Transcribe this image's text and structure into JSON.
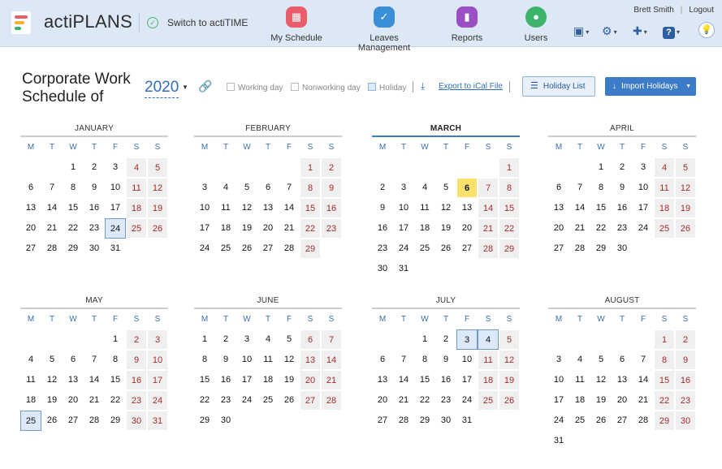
{
  "app": {
    "name": "actiPLANS",
    "switch_label": "Switch to actiTIME"
  },
  "nav": [
    {
      "label": "My Schedule",
      "icon": "calendar-icon",
      "color": "#e95d6b"
    },
    {
      "label": "Leaves Management",
      "icon": "leave-check-icon",
      "color": "#3b8fd6"
    },
    {
      "label": "Reports",
      "icon": "bar-chart-icon",
      "color": "#9b4fc4"
    },
    {
      "label": "Users",
      "icon": "user-icon",
      "color": "#3bb36b"
    }
  ],
  "user": {
    "name": "Brett Smith",
    "logout": "Logout"
  },
  "page": {
    "title": "Corporate Work Schedule of",
    "year": "2020"
  },
  "legend": {
    "working": "Working day",
    "nonworking": "Nonworking day",
    "holiday": "Holiday"
  },
  "actions": {
    "export": "Export to iCal File",
    "holiday_list": "Holiday List",
    "import": "Import Holidays"
  },
  "weekdays": [
    "M",
    "T",
    "W",
    "T",
    "F",
    "S",
    "S"
  ],
  "colors": {
    "accent": "#3b7bc8",
    "weekend_text": "#a52b2b",
    "highlight": "#fbe16b"
  },
  "months": [
    {
      "name": "JANUARY",
      "offset": 2,
      "days": 31,
      "current": false,
      "marked": {
        "24": "today"
      }
    },
    {
      "name": "FEBRUARY",
      "offset": 5,
      "days": 29,
      "current": false,
      "marked": {}
    },
    {
      "name": "MARCH",
      "offset": 6,
      "days": 31,
      "current": true,
      "marked": {
        "6": "hl"
      }
    },
    {
      "name": "APRIL",
      "offset": 2,
      "days": 30,
      "current": false,
      "marked": {}
    },
    {
      "name": "MAY",
      "offset": 4,
      "days": 31,
      "current": false,
      "marked": {
        "25": "sel"
      }
    },
    {
      "name": "JUNE",
      "offset": 0,
      "days": 30,
      "current": false,
      "marked": {}
    },
    {
      "name": "JULY",
      "offset": 2,
      "days": 31,
      "current": false,
      "marked": {
        "3": "sel",
        "4": "sel"
      }
    },
    {
      "name": "AUGUST",
      "offset": 5,
      "days": 31,
      "current": false,
      "marked": {}
    }
  ]
}
